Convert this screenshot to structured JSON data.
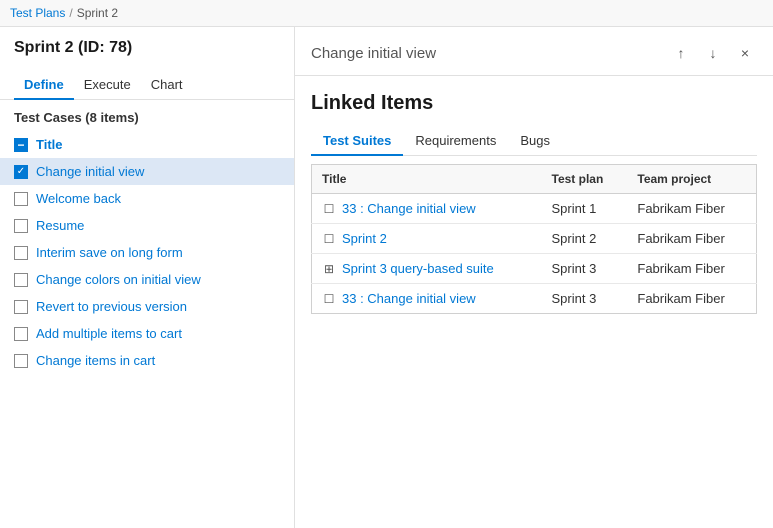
{
  "breadcrumb": {
    "parent": "Test Plans",
    "separator": "/",
    "current": "Sprint 2"
  },
  "left": {
    "title": "Sprint 2 (ID: 78)",
    "tabs": [
      {
        "id": "define",
        "label": "Define",
        "active": true
      },
      {
        "id": "execute",
        "label": "Execute",
        "active": false
      },
      {
        "id": "chart",
        "label": "Chart",
        "active": false
      }
    ],
    "test_cases_header": "Test Cases (8 items)",
    "test_items": [
      {
        "id": "title-row",
        "label": "Title",
        "type": "title",
        "state": "minus"
      },
      {
        "id": "change-initial-view",
        "label": "Change initial view",
        "type": "item",
        "state": "checked",
        "selected": true
      },
      {
        "id": "welcome-back",
        "label": "Welcome back",
        "type": "item",
        "state": "unchecked",
        "selected": false
      },
      {
        "id": "resume",
        "label": "Resume",
        "type": "item",
        "state": "unchecked",
        "selected": false
      },
      {
        "id": "interim-save",
        "label": "Interim save on long form",
        "type": "item",
        "state": "unchecked",
        "selected": false
      },
      {
        "id": "change-colors",
        "label": "Change colors on initial view",
        "type": "item",
        "state": "unchecked",
        "selected": false
      },
      {
        "id": "revert",
        "label": "Revert to previous version",
        "type": "item",
        "state": "unchecked",
        "selected": false
      },
      {
        "id": "add-multiple",
        "label": "Add multiple items to cart",
        "type": "item",
        "state": "unchecked",
        "selected": false
      },
      {
        "id": "change-items",
        "label": "Change items in cart",
        "type": "item",
        "state": "unchecked",
        "selected": false
      }
    ]
  },
  "right": {
    "header_title": "Change initial view",
    "up_icon": "↑",
    "down_icon": "↓",
    "close_icon": "×",
    "linked_items_title": "Linked Items",
    "detail_tabs": [
      {
        "id": "test-suites",
        "label": "Test Suites",
        "active": true
      },
      {
        "id": "requirements",
        "label": "Requirements",
        "active": false
      },
      {
        "id": "bugs",
        "label": "Bugs",
        "active": false
      }
    ],
    "table": {
      "columns": [
        {
          "id": "title",
          "label": "Title"
        },
        {
          "id": "test-plan",
          "label": "Test plan"
        },
        {
          "id": "team-project",
          "label": "Team project"
        }
      ],
      "rows": [
        {
          "title": "33 : Change initial view",
          "icon": "static",
          "test_plan": "Sprint 1",
          "team_project": "Fabrikam Fiber"
        },
        {
          "title": "Sprint 2",
          "icon": "static",
          "test_plan": "Sprint 2",
          "team_project": "Fabrikam Fiber"
        },
        {
          "title": "Sprint 3 query-based suite",
          "icon": "query",
          "test_plan": "Sprint 3",
          "team_project": "Fabrikam Fiber"
        },
        {
          "title": "33 : Change initial view",
          "icon": "static",
          "test_plan": "Sprint 3",
          "team_project": "Fabrikam Fiber"
        }
      ]
    }
  }
}
